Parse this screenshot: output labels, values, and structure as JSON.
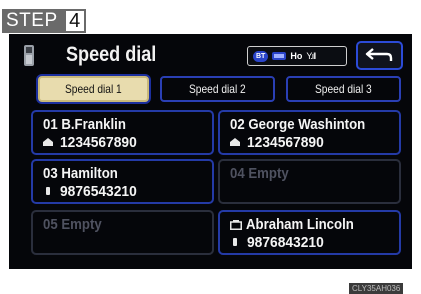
{
  "step": {
    "word": "STEP",
    "number": "4"
  },
  "header": {
    "title": "Speed dial",
    "status": {
      "bt": "BT",
      "ho": "Ho",
      "antenna": "Y.ıll"
    }
  },
  "tabs": [
    {
      "label": "Speed dial 1",
      "active": true
    },
    {
      "label": "Speed dial 2",
      "active": false
    },
    {
      "label": "Speed dial 3",
      "active": false
    }
  ],
  "entries": [
    {
      "name": "01 B.Franklin",
      "number": "1234567890",
      "icon": "home-phone-icon"
    },
    {
      "name": "02 George Washinton",
      "number": "1234567890",
      "icon": "home-phone-icon"
    },
    {
      "name": "03 Hamilton",
      "number": "9876543210",
      "icon": "mobile-phone-icon"
    },
    {
      "name": "04 Empty",
      "number": "",
      "icon": ""
    },
    {
      "name": "05 Empty",
      "number": "",
      "icon": ""
    },
    {
      "name": "Abraham Lincoln",
      "number": "9876843210",
      "icon": "mobile-phone-icon"
    }
  ],
  "image_code": "CLY35AH036",
  "colors": {
    "active_tab": "#e8dcae",
    "button_border": "#243aa6",
    "screen_bg": "#05060a"
  }
}
